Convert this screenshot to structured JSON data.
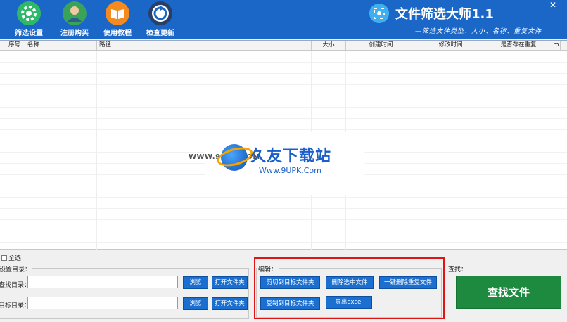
{
  "toolbar": {
    "buttons": [
      {
        "label": "筛选设置",
        "icon": "gear-icon"
      },
      {
        "label": "注册购买",
        "icon": "user-avatar-icon"
      },
      {
        "label": "使用教程",
        "icon": "book-icon"
      },
      {
        "label": "检查更新",
        "icon": "refresh-icon"
      }
    ]
  },
  "brand": {
    "title": "文件筛选大师1.1",
    "subtitle": "—筛选文件类型、大小、名称、重复文件"
  },
  "window": {
    "close": "✕"
  },
  "table": {
    "columns": [
      "序号",
      "名称",
      "路径",
      "大小",
      "创建时间",
      "修改时间",
      "是否存在重复",
      "m"
    ]
  },
  "watermark": {
    "www": "WWW.9UPK.COM",
    "title": "久友下载站",
    "url": "Www.9UPK.Com"
  },
  "bottom": {
    "select_all": "全选",
    "settings_group": "设置目录：",
    "search_dir_label": "查找目录：",
    "target_dir_label": "目标目录：",
    "search_dir_value": "",
    "target_dir_value": "",
    "browse": "浏览",
    "open_folder": "打开文件夹",
    "edit_group": "编辑：",
    "edit_buttons": {
      "cut": "剪切到目标文件夹",
      "delete_selected": "删除选中文件",
      "delete_duplicates": "一键删除重复文件",
      "copy": "复制到目标文件夹",
      "export": "导出excel"
    },
    "find_group": "查找：",
    "find_button": "查找文件"
  },
  "colors": {
    "toolbar_bg": "#1a67c7",
    "button_blue": "#1a6fd0",
    "find_green": "#1e8a40",
    "highlight_red": "#e01414"
  }
}
